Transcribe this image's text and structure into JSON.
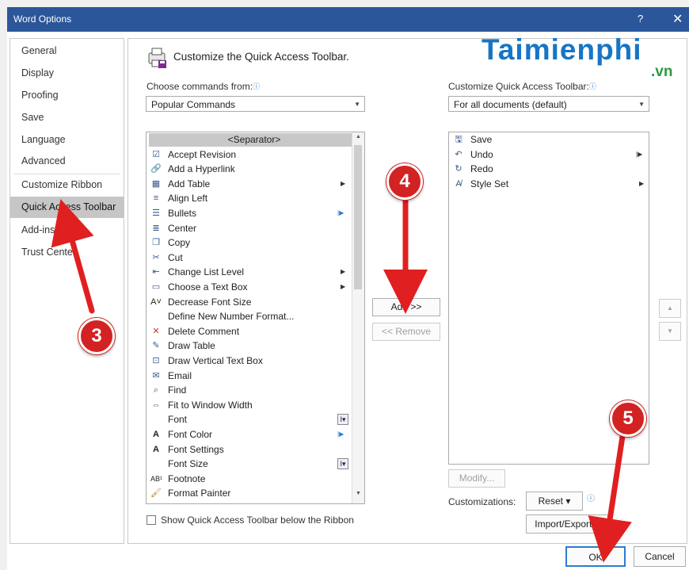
{
  "window": {
    "title": "Word Options",
    "help": "?",
    "close": "✕"
  },
  "nav": {
    "items": [
      {
        "label": "General"
      },
      {
        "label": "Display"
      },
      {
        "label": "Proofing"
      },
      {
        "label": "Save"
      },
      {
        "label": "Language"
      },
      {
        "label": "Advanced"
      },
      {
        "label": "Customize Ribbon"
      },
      {
        "label": "Quick Access Toolbar",
        "selected": true
      },
      {
        "label": "Add-ins"
      },
      {
        "label": "Trust Center"
      }
    ]
  },
  "main": {
    "heading": "Customize the Quick Access Toolbar.",
    "choose_label": "Choose commands from:",
    "choose_value": "Popular Commands",
    "customize_label": "Customize Quick Access Toolbar:",
    "customize_value": "For all documents (default)",
    "commands": [
      {
        "label": "<Separator>",
        "icon": "separator"
      },
      {
        "label": "Accept Revision",
        "icon": "accept-revision-icon"
      },
      {
        "label": "Add a Hyperlink",
        "icon": "hyperlink-icon"
      },
      {
        "label": "Add Table",
        "icon": "table-icon",
        "submenu": true
      },
      {
        "label": "Align Left",
        "icon": "align-left-icon"
      },
      {
        "label": "Bullets",
        "icon": "bullets-icon",
        "split": true
      },
      {
        "label": "Center",
        "icon": "center-icon"
      },
      {
        "label": "Copy",
        "icon": "copy-icon"
      },
      {
        "label": "Cut",
        "icon": "cut-icon"
      },
      {
        "label": "Change List Level",
        "icon": "list-level-icon",
        "submenu": true
      },
      {
        "label": "Choose a Text Box",
        "icon": "text-box-icon",
        "submenu": true
      },
      {
        "label": "Decrease Font Size",
        "icon": "decrease-font-icon"
      },
      {
        "label": "Define New Number Format...",
        "icon": ""
      },
      {
        "label": "Delete Comment",
        "icon": "delete-comment-icon"
      },
      {
        "label": "Draw Table",
        "icon": "draw-table-icon"
      },
      {
        "label": "Draw Vertical Text Box",
        "icon": "vertical-text-box-icon"
      },
      {
        "label": "Email",
        "icon": "email-icon"
      },
      {
        "label": "Find",
        "icon": "find-icon"
      },
      {
        "label": "Fit to Window Width",
        "icon": "fit-width-icon"
      },
      {
        "label": "Font",
        "icon": "",
        "combo": true
      },
      {
        "label": "Font Color",
        "icon": "font-color-icon",
        "split": true
      },
      {
        "label": "Font Settings",
        "icon": "font-settings-icon"
      },
      {
        "label": "Font Size",
        "icon": "",
        "combo": true
      },
      {
        "label": "Footnote",
        "icon": "footnote-icon"
      },
      {
        "label": "Format Painter",
        "icon": "format-painter-icon"
      }
    ],
    "toolbar_items": [
      {
        "label": "Save",
        "icon": "save-icon"
      },
      {
        "label": "Undo",
        "icon": "undo-icon",
        "split": true
      },
      {
        "label": "Redo",
        "icon": "redo-icon"
      },
      {
        "label": "Style Set",
        "icon": "style-set-icon",
        "submenu": true
      }
    ],
    "add_button": "Add >>",
    "remove_button": "<< Remove",
    "modify_button": "Modify...",
    "customizations_label": "Customizations:",
    "reset_button": "Reset ▾",
    "import_export_button": "Import/Export ▾",
    "show_below_label": "Show Quick Access Toolbar below the Ribbon",
    "ok_button": "OK",
    "cancel_button": "Cancel"
  },
  "markers": [
    "3",
    "4",
    "5"
  ],
  "watermark": {
    "brand": "Taimienphi",
    "tld": ".vn"
  },
  "colors": {
    "titlebar": "#2b579a",
    "selected_nav": "#c6c6c6",
    "marker": "#d32222",
    "arrow": "#e02020",
    "brand_blue": "#1775c5",
    "brand_green": "#2d9a3c"
  }
}
